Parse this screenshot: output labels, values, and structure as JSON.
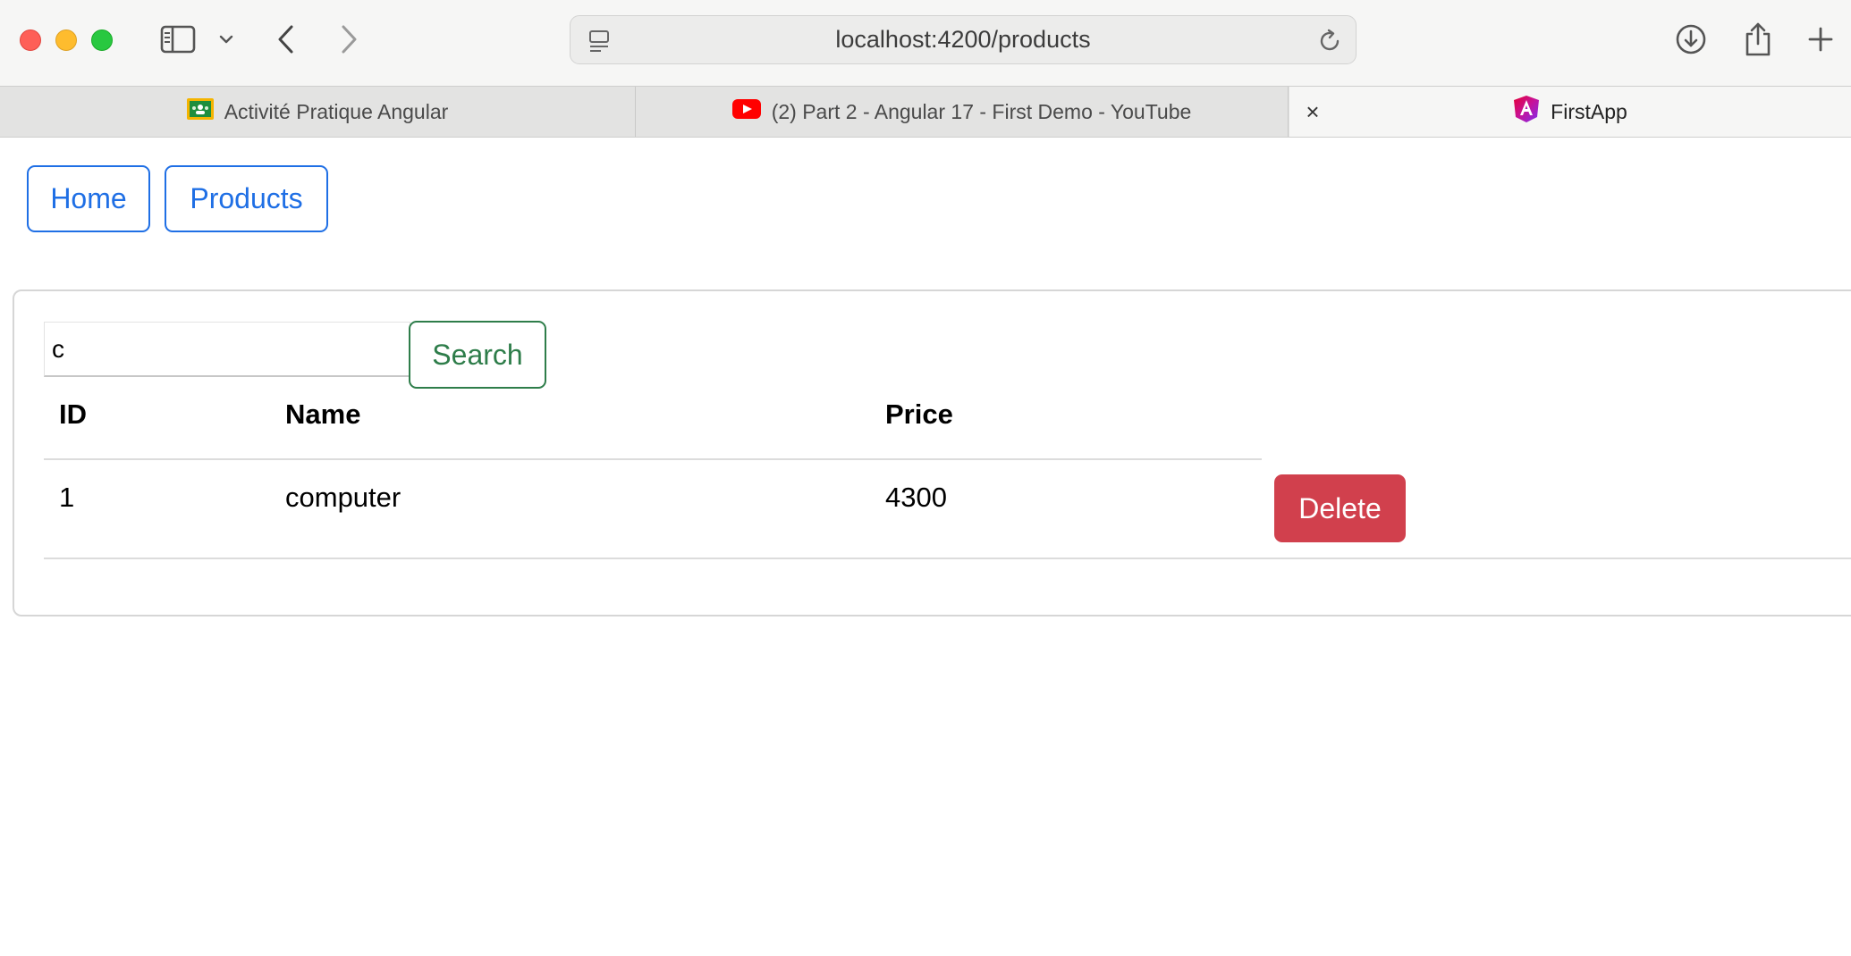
{
  "browser": {
    "url": "localhost:4200/products",
    "tabs": [
      {
        "title": "Activité Pratique Angular",
        "favicon": "google-classroom-icon"
      },
      {
        "title": "(2) Part 2 - Angular 17 - First Demo - YouTube",
        "favicon": "youtube-icon"
      },
      {
        "title": "FirstApp",
        "favicon": "angular-icon"
      }
    ],
    "close_tab_glyph": "×"
  },
  "nav": {
    "home_label": "Home",
    "products_label": "Products"
  },
  "search": {
    "value": "c",
    "button_label": "Search"
  },
  "table": {
    "columns": [
      "ID",
      "Name",
      "Price"
    ],
    "rows": [
      {
        "id": "1",
        "name": "computer",
        "price": "4300",
        "action_label": "Delete"
      }
    ]
  },
  "colors": {
    "primary": "#1f6fe5",
    "success": "#2e7d4a",
    "danger": "#d1404d"
  }
}
